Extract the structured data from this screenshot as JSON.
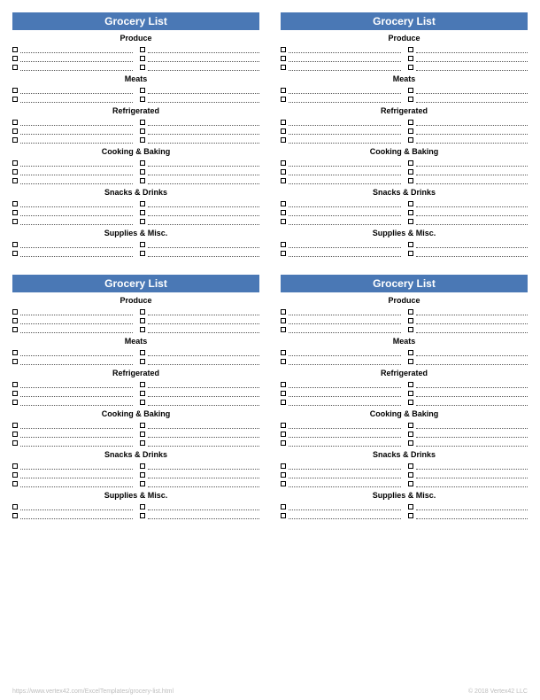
{
  "card_title": "Grocery List",
  "sections": [
    {
      "heading": "Produce",
      "rows": 3
    },
    {
      "heading": "Meats",
      "rows": 2
    },
    {
      "heading": "Refrigerated",
      "rows": 3
    },
    {
      "heading": "Cooking & Baking",
      "rows": 3
    },
    {
      "heading": "Snacks & Drinks",
      "rows": 3
    },
    {
      "heading": "Supplies & Misc.",
      "rows": 2
    }
  ],
  "footer": {
    "url": "https://www.vertex42.com/ExcelTemplates/grocery-list.html",
    "copyright": "© 2018 Vertex42 LLC"
  }
}
